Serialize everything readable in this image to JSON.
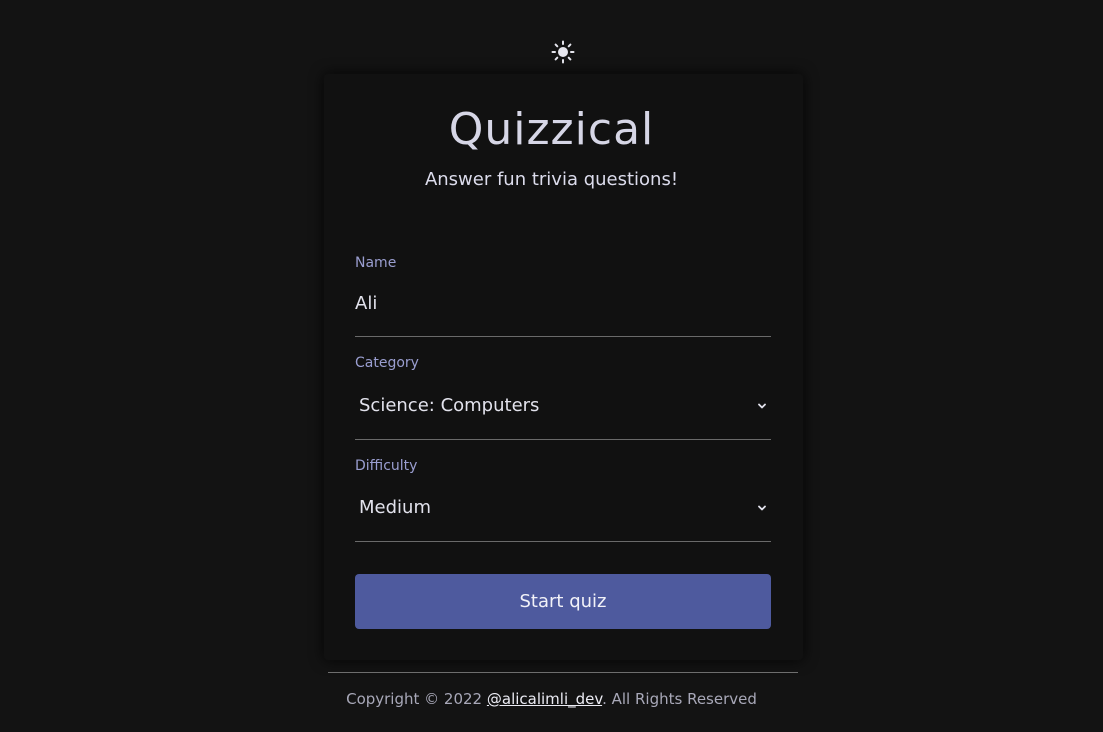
{
  "theme_toggle": {
    "icon": "sun-icon",
    "glyph": "☀"
  },
  "app": {
    "title": "Quizzical",
    "subtitle": "Answer fun trivia questions!"
  },
  "form": {
    "name": {
      "label": "Name",
      "value": "Ali"
    },
    "category": {
      "label": "Category",
      "selected": "Science: Computers",
      "icon": "chevron-down-icon"
    },
    "difficulty": {
      "label": "Difficulty",
      "selected": "Medium",
      "icon": "chevron-down-icon"
    },
    "submit_label": "Start quiz"
  },
  "footer": {
    "prefix": "Copyright © 2022 ",
    "link_text": "@alicalimli_dev",
    "suffix": ". All Rights Reserved"
  },
  "colors": {
    "background": "#131313",
    "card": "#111111",
    "accent": "#4e5a9e",
    "label": "#9a9ed0"
  }
}
